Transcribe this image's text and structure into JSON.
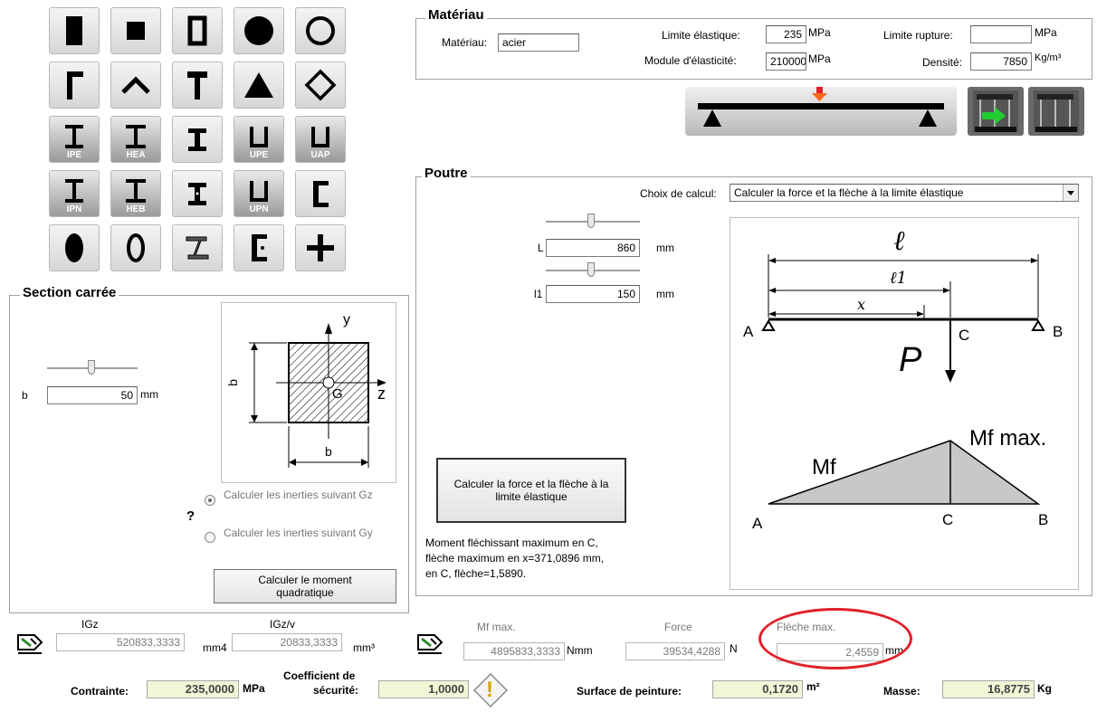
{
  "shapes": {
    "row1": [
      "rectangle-filled",
      "square-filled",
      "rectangle-hollow",
      "circle-filled",
      "circle-hollow"
    ],
    "row2": [
      "angle",
      "angle-rotated",
      "t-section",
      "triangle",
      "diamond-hollow"
    ],
    "row3": [
      {
        "icon": "i-beam",
        "tag": "IPE"
      },
      {
        "icon": "i-beam",
        "tag": "HEA"
      },
      {
        "icon": "i-beam",
        "tag": ""
      },
      {
        "icon": "channel",
        "tag": "UPE"
      },
      {
        "icon": "channel",
        "tag": "UAP"
      }
    ],
    "row4": [
      {
        "icon": "i-beam",
        "tag": "IPN"
      },
      {
        "icon": "i-beam",
        "tag": "HEB"
      },
      {
        "icon": "i-beam",
        "tag": ""
      },
      {
        "icon": "channel",
        "tag": "UPN"
      },
      {
        "icon": "c-channel",
        "tag": ""
      }
    ],
    "row5": [
      "ellipse-filled",
      "ellipse-hollow",
      "z-section",
      "c-section",
      "cross"
    ]
  },
  "section": {
    "title": "Section carrée",
    "b_label": "b",
    "b_value": "50",
    "b_unit": "mm",
    "radio1": "Calculer les inerties suivant Gz",
    "radio2": "Calculer les inerties suivant Gy",
    "help": "?",
    "calc_button": "Calculer le moment quadratique",
    "diagram": {
      "y": "y",
      "z": "z",
      "g": "G",
      "b_vert": "b",
      "b_horiz": "b"
    }
  },
  "materiau": {
    "title": "Matériau",
    "mat_label": "Matériau:",
    "mat_value": "acier",
    "lim_el_label": "Limite élastique:",
    "lim_el_value": "235",
    "lim_el_unit": "MPa",
    "lim_rup_label": "Limite rupture:",
    "lim_rup_value": "",
    "lim_rup_unit": "MPa",
    "module_label": "Module d'élasticité:",
    "module_value": "210000",
    "module_unit": "MPa",
    "densite_label": "Densité:",
    "densite_value": "7850",
    "densite_unit": "Kg/m³"
  },
  "poutre": {
    "title": "Poutre",
    "choix_label": "Choix de calcul:",
    "choix_value": "Calculer la force et la flèche à la limite élastique",
    "L_label": "L",
    "L_value": "860",
    "L_unit": "mm",
    "l1_label": "l1",
    "l1_value": "150",
    "l1_unit": "mm",
    "calc_button": "Calculer la force et la flèche à la limite élastique",
    "result_text_1": "Moment fléchissant maximum en C,",
    "result_text_2": "flèche maximum en x=371,0896 mm,",
    "result_text_3": "en C, flèche=1,5890.",
    "diagram": {
      "l": "ℓ",
      "l1": "ℓ1",
      "x": "x",
      "A": "A",
      "B": "B",
      "C": "C",
      "P": "P",
      "mf": "Mf",
      "mfmax": "Mf max.",
      "A2": "A",
      "C2": "C",
      "B2": "B"
    }
  },
  "results": {
    "igz_label": "IGz",
    "igz_value": "520833,3333",
    "igz_unit": "mm4",
    "igzv_label": "IGz/v",
    "igzv_value": "20833,3333",
    "igzv_unit": "mm³",
    "mfmax_label": "Mf max.",
    "mfmax_value": "4895833,3333",
    "mfmax_unit": "Nmm",
    "force_label": "Force",
    "force_value": "39534,4288",
    "force_unit": "N",
    "fleche_label": "Flèche max.",
    "fleche_value": "2,4559",
    "fleche_unit": "mm",
    "contrainte_label": "Contrainte:",
    "contrainte_value": "235,0000",
    "contrainte_unit": "MPa",
    "coef_label_1": "Coefficient de",
    "coef_label_2": "sécurité:",
    "coef_value": "1,0000",
    "surface_label": "Surface de peinture:",
    "surface_value": "0,1720",
    "surface_unit": "m²",
    "masse_label": "Masse:",
    "masse_value": "16,8775",
    "masse_unit": "Kg",
    "warning_glyph": "!"
  },
  "colors": {
    "highlight": "#e0202a",
    "beam_arrow": "#ff5a1a",
    "shape_icon": "#000000",
    "sub_icon": "#2e8a2e"
  }
}
